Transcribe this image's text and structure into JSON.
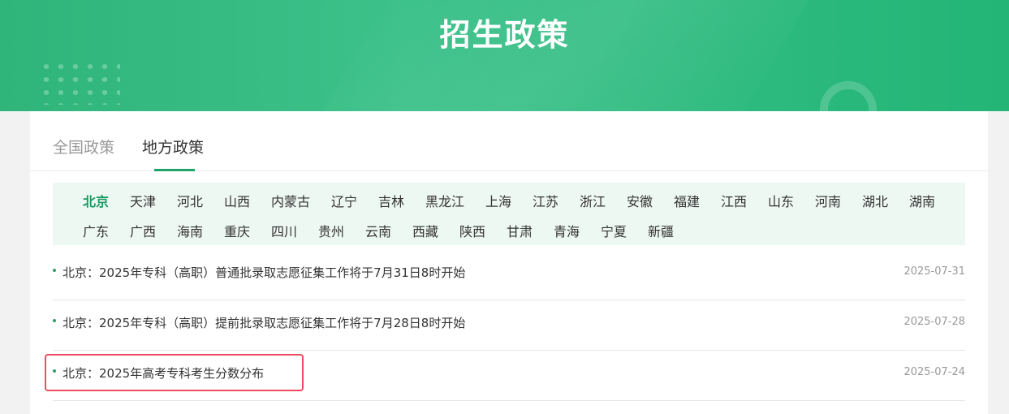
{
  "header": {
    "title": "招生政策"
  },
  "tabs": [
    {
      "label": "全国政策"
    },
    {
      "label": "地方政策"
    }
  ],
  "regions": {
    "row1": [
      "北京",
      "天津",
      "河北",
      "山西",
      "内蒙古",
      "辽宁",
      "吉林",
      "黑龙江",
      "上海",
      "江苏",
      "浙江",
      "安徽",
      "福建",
      "江西",
      "山东",
      "河南",
      "湖北",
      "湖南"
    ],
    "row2": [
      "广东",
      "广西",
      "海南",
      "重庆",
      "四川",
      "贵州",
      "云南",
      "西藏",
      "陕西",
      "甘肃",
      "青海",
      "宁夏",
      "新疆"
    ]
  },
  "news": [
    {
      "title": "北京：2025年专科（高职）普通批录取志愿征集工作将于7月31日8时开始",
      "date": "2025-07-31"
    },
    {
      "title": "北京：2025年专科（高职）提前批录取志愿征集工作将于7月28日8时开始",
      "date": "2025-07-28"
    },
    {
      "title": "北京：2025年高考专科考生分数分布",
      "date": "2025-07-24"
    }
  ],
  "colors": {
    "accent": "#1fa36a",
    "highlight": "#ef4c62"
  }
}
